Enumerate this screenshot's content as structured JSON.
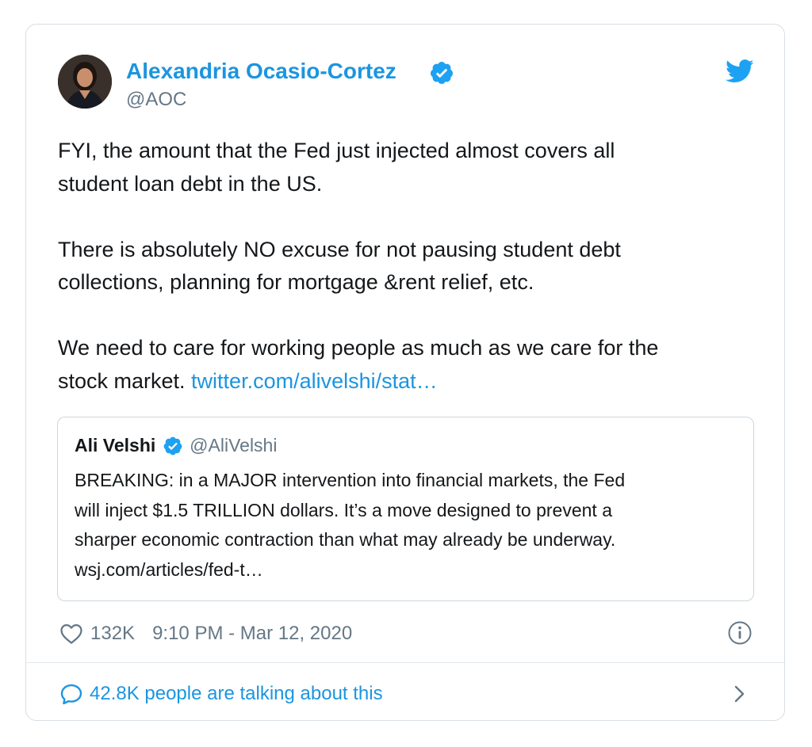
{
  "tweet": {
    "author": {
      "name": "Alexandria Ocasio-Cortez",
      "handle": "@AOC",
      "avatar_icon": "profile-photo",
      "verified_icon": "verified-badge-icon"
    },
    "paragraphs": [
      [
        "FYI, the amount that the Fed just injected almost covers all",
        "student loan debt in the US."
      ],
      [
        "There is absolutely NO excuse for not pausing student debt",
        "collections, planning for mortgage &rent relief, etc."
      ],
      [
        "We need to care for working people as much as we care for the",
        "stock market. "
      ]
    ],
    "link_text": "twitter.com/alivelshi/stat…",
    "quoted": {
      "name": "Ali Velshi",
      "handle": "@AliVelshi",
      "lines": [
        "BREAKING: in a MAJOR intervention into financial markets, the Fed",
        "will inject $1.5 TRILLION dollars. It’s a move designed to prevent a",
        "sharper economic contraction than what may already be underway.",
        "wsj.com/articles/fed-t…"
      ]
    },
    "likes": "132K",
    "timestamp": "9:10 PM - Mar 12, 2020",
    "talking": "42.8K people are talking about this"
  },
  "colors": {
    "accent": "#1b95e0",
    "text": "#14171a",
    "muted": "#657786",
    "border": "#ccd6dd"
  }
}
